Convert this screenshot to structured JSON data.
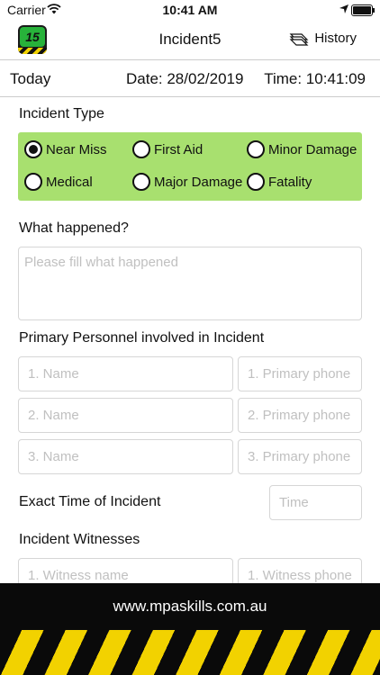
{
  "status_bar": {
    "carrier": "Carrier",
    "time": "10:41 AM"
  },
  "nav": {
    "title": "Incident5",
    "history_label": "History",
    "logo_text": "15"
  },
  "date_bar": {
    "today": "Today",
    "date": "Date: 28/02/2019",
    "time": "Time: 10:41:09"
  },
  "incident_type": {
    "label": "Incident Type",
    "options": [
      "Near Miss",
      "First Aid",
      "Minor Damage",
      "Medical",
      "Major Damage",
      "Fatality"
    ],
    "selected": "Near Miss"
  },
  "what_happened": {
    "label": "What happened?",
    "placeholder": "Please fill what happened"
  },
  "personnel": {
    "label": "Primary Personnel involved in Incident",
    "name_placeholders": [
      "1. Name",
      "2. Name",
      "3. Name"
    ],
    "phone_placeholders": [
      "1. Primary phone",
      "2. Primary phone",
      "3. Primary phone"
    ]
  },
  "exact_time": {
    "label": "Exact Time of Incident",
    "placeholder": "Time"
  },
  "witnesses": {
    "label": "Incident Witnesses",
    "name_placeholder": "1. Witness name",
    "phone_placeholder": "1. Witness phone"
  },
  "footer": {
    "url": "www.mpaskills.com.au"
  },
  "colors": {
    "radio_bg": "#a8e06f",
    "hazard_yellow": "#f2d200",
    "logo_green": "#27b23a"
  }
}
